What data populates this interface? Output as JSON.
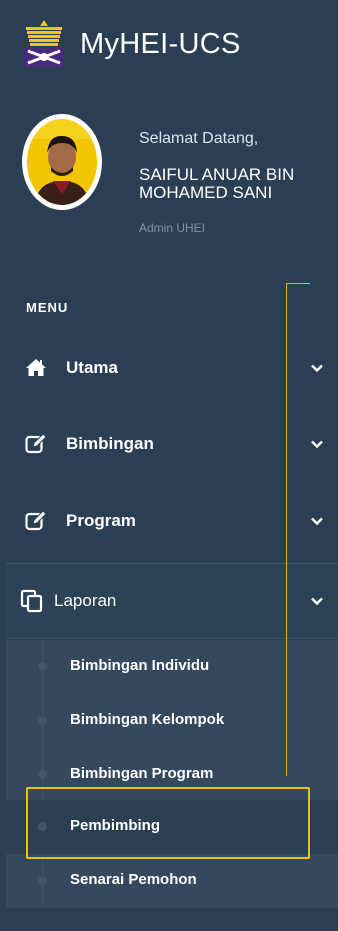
{
  "app": {
    "title": "MyHEI-UCS"
  },
  "profile": {
    "greeting": "Selamat Datang,",
    "name": "SAIFUL ANUAR BIN MOHAMED SANI",
    "role": "Admin UHEI"
  },
  "menu": {
    "title": "MENU",
    "items": [
      {
        "label": "Utama",
        "icon": "home-icon"
      },
      {
        "label": "Bimbingan",
        "icon": "edit-icon"
      },
      {
        "label": "Program",
        "icon": "edit-icon"
      },
      {
        "label": "Laporan",
        "icon": "copy-icon",
        "expanded": true
      }
    ],
    "submenu": [
      {
        "label": "Bimbingan Individu"
      },
      {
        "label": "Bimbingan Kelompok"
      },
      {
        "label": "Bimbingan Program"
      },
      {
        "label": "Pembimbing",
        "active": true
      },
      {
        "label": "Senarai Pemohon"
      }
    ]
  },
  "colors": {
    "sidebar_bg": "#2a3f54",
    "submenu_bg": "#35495e",
    "highlight": "#f2c200"
  }
}
